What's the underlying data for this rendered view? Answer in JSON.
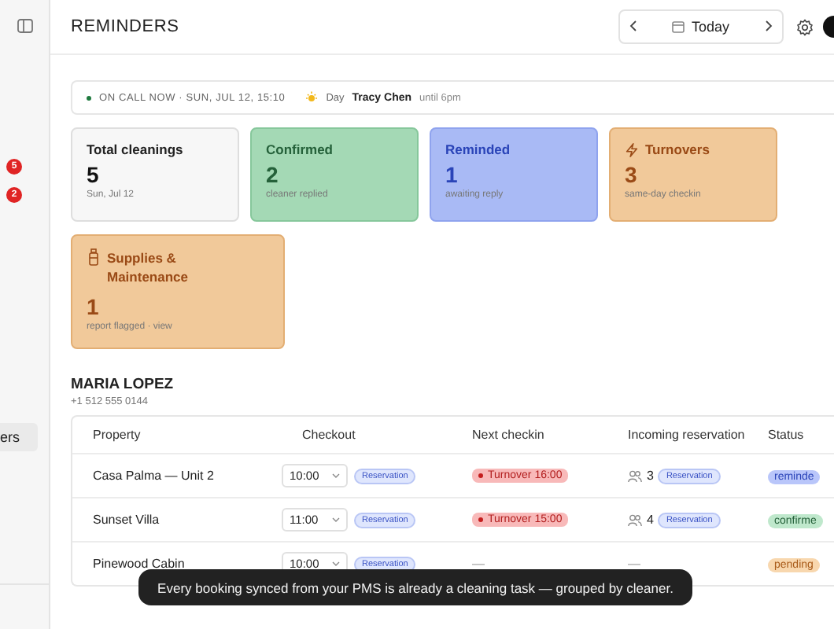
{
  "sidebar": {
    "badges": [
      "5",
      "2"
    ],
    "items": [
      {
        "label": "ers",
        "selected": true
      }
    ]
  },
  "header": {
    "title": "REMINDERS",
    "date_label": "Today"
  },
  "on_call": {
    "label": "ON CALL NOW · SUN, JUL 12, 15:10",
    "shift": "Day",
    "person": "Tracy Chen",
    "until": "until 6pm"
  },
  "stat_cards": [
    {
      "kind": "total",
      "title": "Total cleanings",
      "value": "5",
      "caption": "Sun, Jul 12"
    },
    {
      "kind": "confirmed",
      "title": "Confirmed",
      "value": "2",
      "caption": "cleaner replied"
    },
    {
      "kind": "reminded",
      "title": "Reminded",
      "value": "1",
      "caption": "awaiting reply"
    },
    {
      "kind": "turnovers",
      "title": "Turnovers",
      "value": "3",
      "caption": "same-day checkin"
    },
    {
      "kind": "supplies",
      "title": "Supplies & Maintenance",
      "value": "1",
      "caption": "report flagged · view"
    }
  ],
  "cleaners": [
    {
      "name": "MARIA LOPEZ",
      "phone": "+1 512 555 0144",
      "columns": [
        "Property",
        "Checkout",
        "Next checkin",
        "Incoming reservation",
        "Status"
      ],
      "rows": [
        {
          "property": "Casa Palma — Unit 2",
          "checkout": "10:00",
          "checkout_tag": "Reservation",
          "next_checkin": {
            "kind": "turnover",
            "text": "Turnover 16:00"
          },
          "incoming": {
            "kind": "booking",
            "guests": "3",
            "tag": "Reservation"
          },
          "status": {
            "kind": "reminded",
            "text": "reminde"
          }
        },
        {
          "property": "Sunset Villa",
          "checkout": "11:00",
          "checkout_tag": "Reservation",
          "next_checkin": {
            "kind": "turnover",
            "text": "Turnover 15:00"
          },
          "incoming": {
            "kind": "booking",
            "guests": "4",
            "tag": "Reservation"
          },
          "status": {
            "kind": "confirmed",
            "text": "confirme"
          }
        },
        {
          "property": "Pinewood Cabin",
          "checkout": "10:00",
          "checkout_tag": "Reservation",
          "next_checkin": {
            "kind": "empty",
            "text": "—"
          },
          "incoming": {
            "kind": "empty",
            "text": "—"
          },
          "status": {
            "kind": "pending",
            "text": "pending"
          }
        }
      ]
    }
  ],
  "tooltip": "Every booking synced from your PMS is already a cleaning task — grouped by cleaner."
}
